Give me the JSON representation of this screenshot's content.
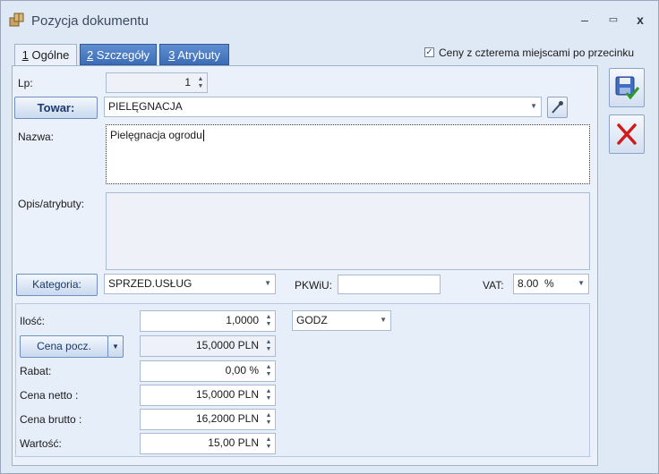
{
  "window": {
    "title": "Pozycja dokumentu",
    "min_glyph": "–",
    "max_glyph": "▭",
    "close_glyph": "x"
  },
  "tabs": [
    {
      "accel": "1",
      "label": " Ogólne"
    },
    {
      "accel": "2",
      "label": " Szczegóły"
    },
    {
      "accel": "3",
      "label": " Atrybuty"
    }
  ],
  "four_decimals": {
    "label": "Ceny z czterema miejscami po przecinku",
    "checked": true
  },
  "lp": {
    "label": "Lp:",
    "value": "1"
  },
  "towar": {
    "button": "Towar:",
    "value": "PIELĘGNACJA"
  },
  "nazwa": {
    "label": "Nazwa:",
    "value": "Pielęgnacja ogrodu"
  },
  "opis": {
    "label": "Opis/atrybuty:",
    "value": ""
  },
  "kategoria": {
    "button": "Kategoria:",
    "value": "SPRZED.USŁUG"
  },
  "pkwiu": {
    "label": "PKWiU:",
    "value": ""
  },
  "vat": {
    "label": "VAT:",
    "value": "8.00  %"
  },
  "ilosc": {
    "label": "Ilość:",
    "value": "1,0000",
    "unit": "GODZ"
  },
  "cena_pocz": {
    "button": "Cena pocz.",
    "value": "15,0000 PLN"
  },
  "rabat": {
    "label": "Rabat:",
    "value": "0,00 %"
  },
  "cena_netto": {
    "label": "Cena netto :",
    "value": "15,0000 PLN"
  },
  "cena_brutto": {
    "label": "Cena brutto :",
    "value": "16,2000 PLN"
  },
  "wartosc": {
    "label": "Wartość:",
    "value": "15,00 PLN"
  }
}
